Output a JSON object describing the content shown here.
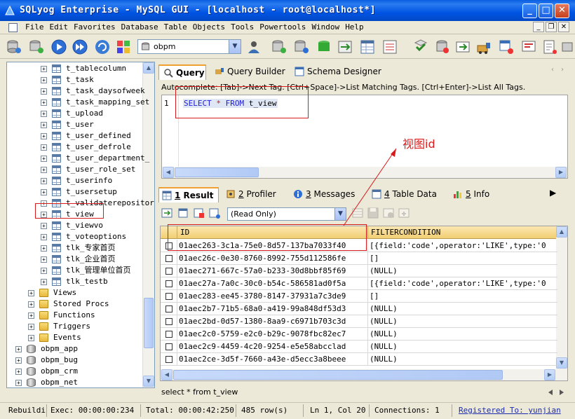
{
  "window": {
    "title": "SQLyog Enterprise - MySQL GUI - [localhost - root@localhost*]",
    "buttons": {
      "minimize": "_",
      "maximize": "□",
      "close": "✕"
    }
  },
  "menu": {
    "items": [
      "File",
      "Edit",
      "Favorites",
      "Database",
      "Table",
      "Objects",
      "Tools",
      "Powertools",
      "Window",
      "Help"
    ],
    "mdi": {
      "minimize": "_",
      "restore": "❐",
      "close": "✕"
    }
  },
  "toolbar": {
    "database_select": "obpm",
    "icons": [
      "connect-icon",
      "new-connection-icon",
      "execute-icon",
      "execute-all-icon",
      "refresh-icon",
      "object-browser-icon",
      "user-manager-icon",
      "backup-icon",
      "restore-icon",
      "import-icon",
      "export-icon",
      "table-data-icon",
      "schema-sync-icon",
      "data-sync-icon",
      "migration-icon",
      "scheduler-icon",
      "query-builder-icon",
      "schema-designer-icon",
      "visual-data-compare-icon"
    ]
  },
  "tree": {
    "items": [
      {
        "label": "t_tablecolumn",
        "type": "table"
      },
      {
        "label": "t_task",
        "type": "table"
      },
      {
        "label": "t_task_daysofweek",
        "type": "table"
      },
      {
        "label": "t_task_mapping_set",
        "type": "table"
      },
      {
        "label": "t_upload",
        "type": "table"
      },
      {
        "label": "t_user",
        "type": "table"
      },
      {
        "label": "t_user_defined",
        "type": "table"
      },
      {
        "label": "t_user_defrole",
        "type": "table"
      },
      {
        "label": "t_user_department_",
        "type": "table"
      },
      {
        "label": "t_user_role_set",
        "type": "table"
      },
      {
        "label": "t_userinfo",
        "type": "table"
      },
      {
        "label": "t_usersetup",
        "type": "table"
      },
      {
        "label": "t_validaterepositor",
        "type": "table"
      },
      {
        "label": "t_view",
        "type": "table"
      },
      {
        "label": "t_viewvo",
        "type": "table"
      },
      {
        "label": "t_voteoptions",
        "type": "table"
      },
      {
        "label": "tlk_专家首页",
        "type": "table"
      },
      {
        "label": "tlk_企业首页",
        "type": "table"
      },
      {
        "label": "tlk_管理单位首页",
        "type": "table"
      },
      {
        "label": "tlk_testb",
        "type": "table"
      },
      {
        "label": "Views",
        "type": "folder"
      },
      {
        "label": "Stored Procs",
        "type": "folder"
      },
      {
        "label": "Functions",
        "type": "folder"
      },
      {
        "label": "Triggers",
        "type": "folder"
      },
      {
        "label": "Events",
        "type": "folder"
      },
      {
        "label": "obpm_app",
        "type": "db"
      },
      {
        "label": "obpm_bug",
        "type": "db"
      },
      {
        "label": "obpm_crm",
        "type": "db"
      },
      {
        "label": "obpm_net",
        "type": "db"
      }
    ]
  },
  "query_tabs": [
    {
      "label": "Query",
      "active": true
    },
    {
      "label": "Query Builder",
      "active": false
    },
    {
      "label": "Schema Designer",
      "active": false
    }
  ],
  "editor": {
    "autocomplete_hint": "Autocomplete: [Tab]->Next Tag. [Ctrl+Space]->List Matching Tags. [Ctrl+Enter]->List All Tags.",
    "line_number": "1",
    "sql": {
      "select": "SELECT",
      "star": "*",
      "from": "FROM",
      "table": "t_view"
    }
  },
  "result_tabs": [
    {
      "num": "1",
      "label": "Result",
      "active": true
    },
    {
      "num": "2",
      "label": "Profiler",
      "active": false
    },
    {
      "num": "3",
      "label": "Messages",
      "active": false
    },
    {
      "num": "4",
      "label": "Table Data",
      "active": false
    },
    {
      "num": "5",
      "label": "Info",
      "active": false
    }
  ],
  "result_toolbar": {
    "mode": "(Read Only)"
  },
  "grid": {
    "columns": [
      "ID",
      "FILTERCONDITION"
    ],
    "rows": [
      [
        "01aec263-3c1a-75e0-8d57-137ba7033f40",
        "[{field:'code',operator:'LIKE',type:'0"
      ],
      [
        "01aec26c-0e30-8760-8992-755d112586fe",
        "[]"
      ],
      [
        "01aec271-667c-57a0-b233-30d8bbf85f69",
        "(NULL)"
      ],
      [
        "01aec27a-7a0c-30c0-b54c-586581ad0f5a",
        "[{field:'code',operator:'LIKE',type:'0"
      ],
      [
        "01aec283-ee45-3780-8147-37931a7c3de9",
        "[]"
      ],
      [
        "01aec2b7-71b5-68a0-a419-99a848df53d3",
        "(NULL)"
      ],
      [
        "01aec2bd-0d57-1380-8aa9-c6971b703c3d",
        "(NULL)"
      ],
      [
        "01aec2c0-5759-e2c0-b29c-9078fbc82ec7",
        "(NULL)"
      ],
      [
        "01aec2c9-4459-4c20-9254-e5e58abcclad",
        "(NULL)"
      ],
      [
        "01aec2ce-3d5f-7660-a43e-d5ecc3a8beee",
        "(NULL)"
      ]
    ]
  },
  "sql_status": "select * from t_view",
  "annotation": {
    "label": "视图id",
    "color": "#e01a1a"
  },
  "statusbar": {
    "rebuild": "Rebuildi",
    "exec": "Exec: 00:00:00:234",
    "total": "Total: 00:00:42:250",
    "rows": "485 row(s)",
    "position": "Ln 1, Col 20",
    "connections": "Connections: 1",
    "registered": "Registered To: yunjian"
  }
}
